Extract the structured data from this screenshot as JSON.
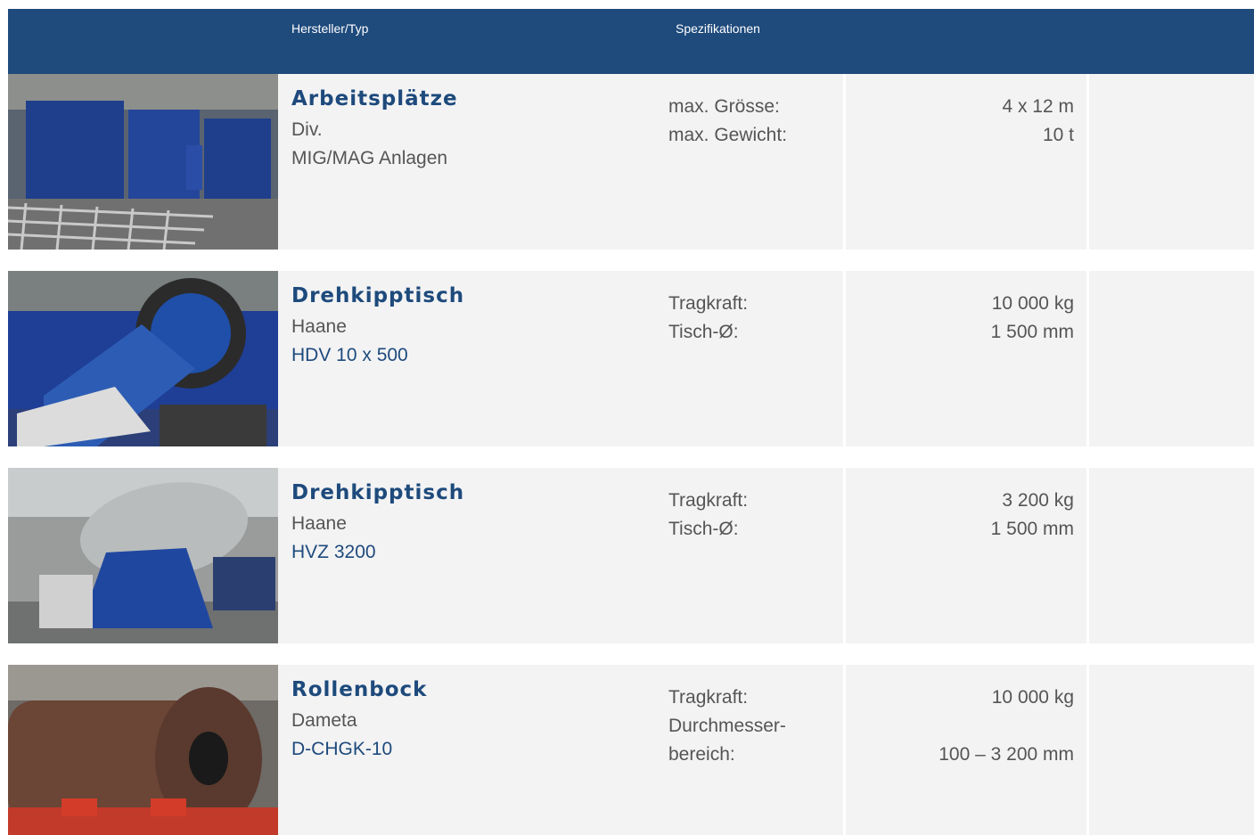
{
  "header": {
    "col_maker": "Hersteller/Typ",
    "col_specs": "Spezifikationen"
  },
  "rows": [
    {
      "title": "Arbeitsplätze",
      "maker": "Div.",
      "model": "MIG/MAG Anlagen",
      "spec_labels": [
        "max. Grösse:",
        "max. Gewicht:"
      ],
      "spec_values": [
        "4 x 12 m",
        "10 t"
      ]
    },
    {
      "title": "Drehkipptisch",
      "maker": "Haane",
      "model": "HDV 10 x 500",
      "spec_labels": [
        "Tragkraft:",
        "Tisch-Ø:"
      ],
      "spec_values": [
        "10 000 kg",
        "1 500 mm"
      ]
    },
    {
      "title": "Drehkipptisch",
      "maker": "Haane",
      "model": "HVZ 3200",
      "spec_labels": [
        "Tragkraft:",
        "Tisch-Ø:"
      ],
      "spec_values": [
        "3 200 kg",
        "1 500 mm"
      ]
    },
    {
      "title": "Rollenbock",
      "maker": "Dameta",
      "model": "D-CHGK-10",
      "spec_labels": [
        "Tragkraft:",
        "Durchmesser-",
        "bereich:"
      ],
      "spec_values": [
        "10 000 kg",
        "",
        "100 – 3 200 mm"
      ]
    }
  ]
}
